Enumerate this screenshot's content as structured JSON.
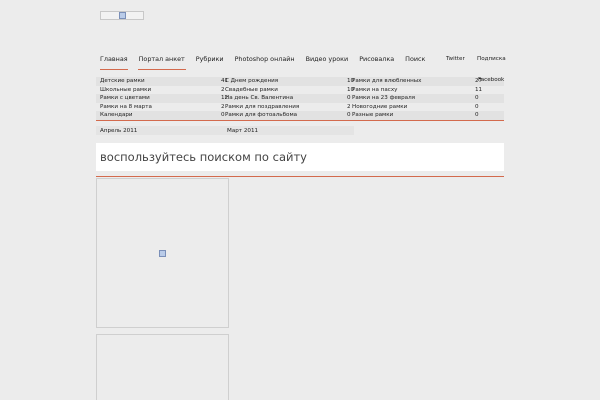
{
  "nav": {
    "items": [
      {
        "label": "Главная"
      },
      {
        "label": "Портал анкет"
      },
      {
        "label": "Рубрики"
      },
      {
        "label": "Photoshop онлайн"
      },
      {
        "label": "Видео уроки"
      },
      {
        "label": "Рисовалка"
      },
      {
        "label": "Поиск"
      }
    ]
  },
  "top_links": {
    "twitter": "Twitter",
    "subscribe": "Подписка",
    "facebook": "Facebook"
  },
  "categories": [
    [
      {
        "name": "Детские рамки",
        "count": "41"
      },
      {
        "name": "С Днем рождения",
        "count": "10"
      },
      {
        "name": "Рамки для влюбленных",
        "count": "27"
      }
    ],
    [
      {
        "name": "Школьные рамки",
        "count": "2"
      },
      {
        "name": "Свадебные рамки",
        "count": "10"
      },
      {
        "name": "Рамки на пасху",
        "count": "11"
      }
    ],
    [
      {
        "name": "Рамки с цветами",
        "count": "12"
      },
      {
        "name": "На день Св. Валентина",
        "count": "0"
      },
      {
        "name": "Рамки на 23 февраля",
        "count": "0"
      }
    ],
    [
      {
        "name": "Рамки на 8 марта",
        "count": "2"
      },
      {
        "name": "Рамки для поздравления",
        "count": "2"
      },
      {
        "name": "Новогодние рамки",
        "count": "0"
      }
    ],
    [
      {
        "name": "Календари",
        "count": "0"
      },
      {
        "name": "Рамки для фотоальбома",
        "count": "0"
      },
      {
        "name": "Разные рамки",
        "count": "0"
      }
    ]
  ],
  "archive": {
    "month1": "Апрель 2011",
    "month2": "Март 2011"
  },
  "search": {
    "hint": "воспользуйтесь поиском по сайту"
  },
  "colors": {
    "accent": "#d36a4d",
    "background": "#ececec"
  }
}
